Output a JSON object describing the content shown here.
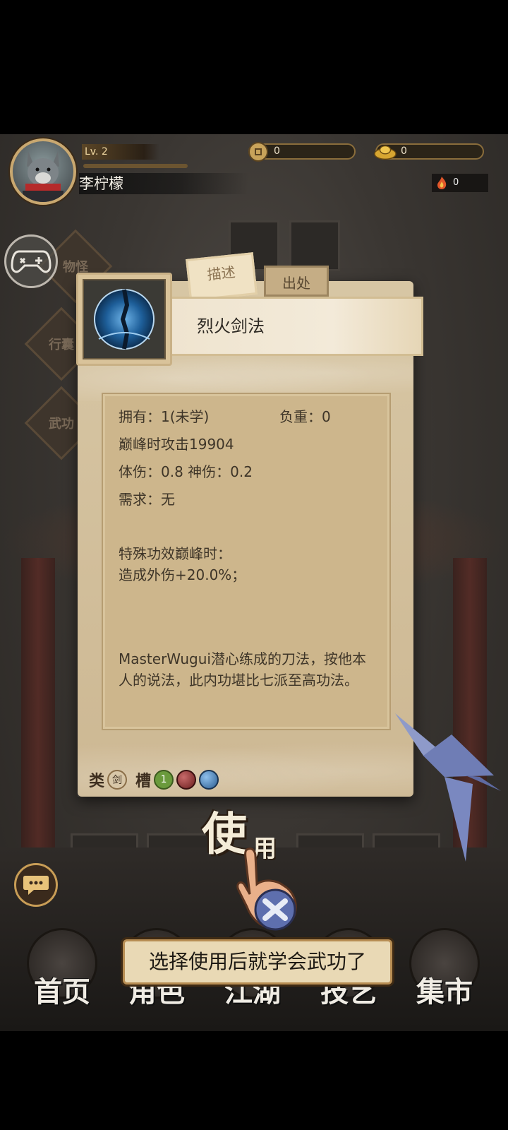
{
  "header": {
    "level": "Lv. 2",
    "player_name": "李柠檬",
    "copper": "0",
    "gold": "0",
    "fire_count": "0"
  },
  "background": {
    "menu_labels": [
      "物怪",
      "行囊",
      "武功"
    ]
  },
  "item": {
    "tabs": [
      "描述",
      "出处"
    ],
    "active_tab": "描述",
    "name": "烈火剑法",
    "own": "拥有：1(未学)",
    "weight": "负重：0",
    "peak_attack": "巅峰时攻击19904",
    "damage": "体伤：0.8 神伤：0.2",
    "requirement": "需求：无",
    "special_title": "特殊功效巅峰时：",
    "special_effect": "造成外伤+20.0%；",
    "description": "MasterWugui潜心练成的刀法，按他本人的说法，此内功堪比七派至高功法。",
    "type_label": "类",
    "type_value": "剑",
    "slot_label": "槽",
    "slot_number": "1"
  },
  "use_button": {
    "big": "使",
    "small": "用"
  },
  "tooltip": "选择使用后就学会武功了",
  "nav": [
    {
      "label": "首页"
    },
    {
      "label": "角色"
    },
    {
      "label": "江湖"
    },
    {
      "label": "技艺"
    },
    {
      "label": "集市"
    }
  ],
  "colors": {
    "parchment": "#d7c6a4",
    "gold_border": "#c9a870",
    "slot_green": "#6a9a3c",
    "slot_red": "#8a2e2e",
    "slot_blue": "#3f6e9c"
  }
}
